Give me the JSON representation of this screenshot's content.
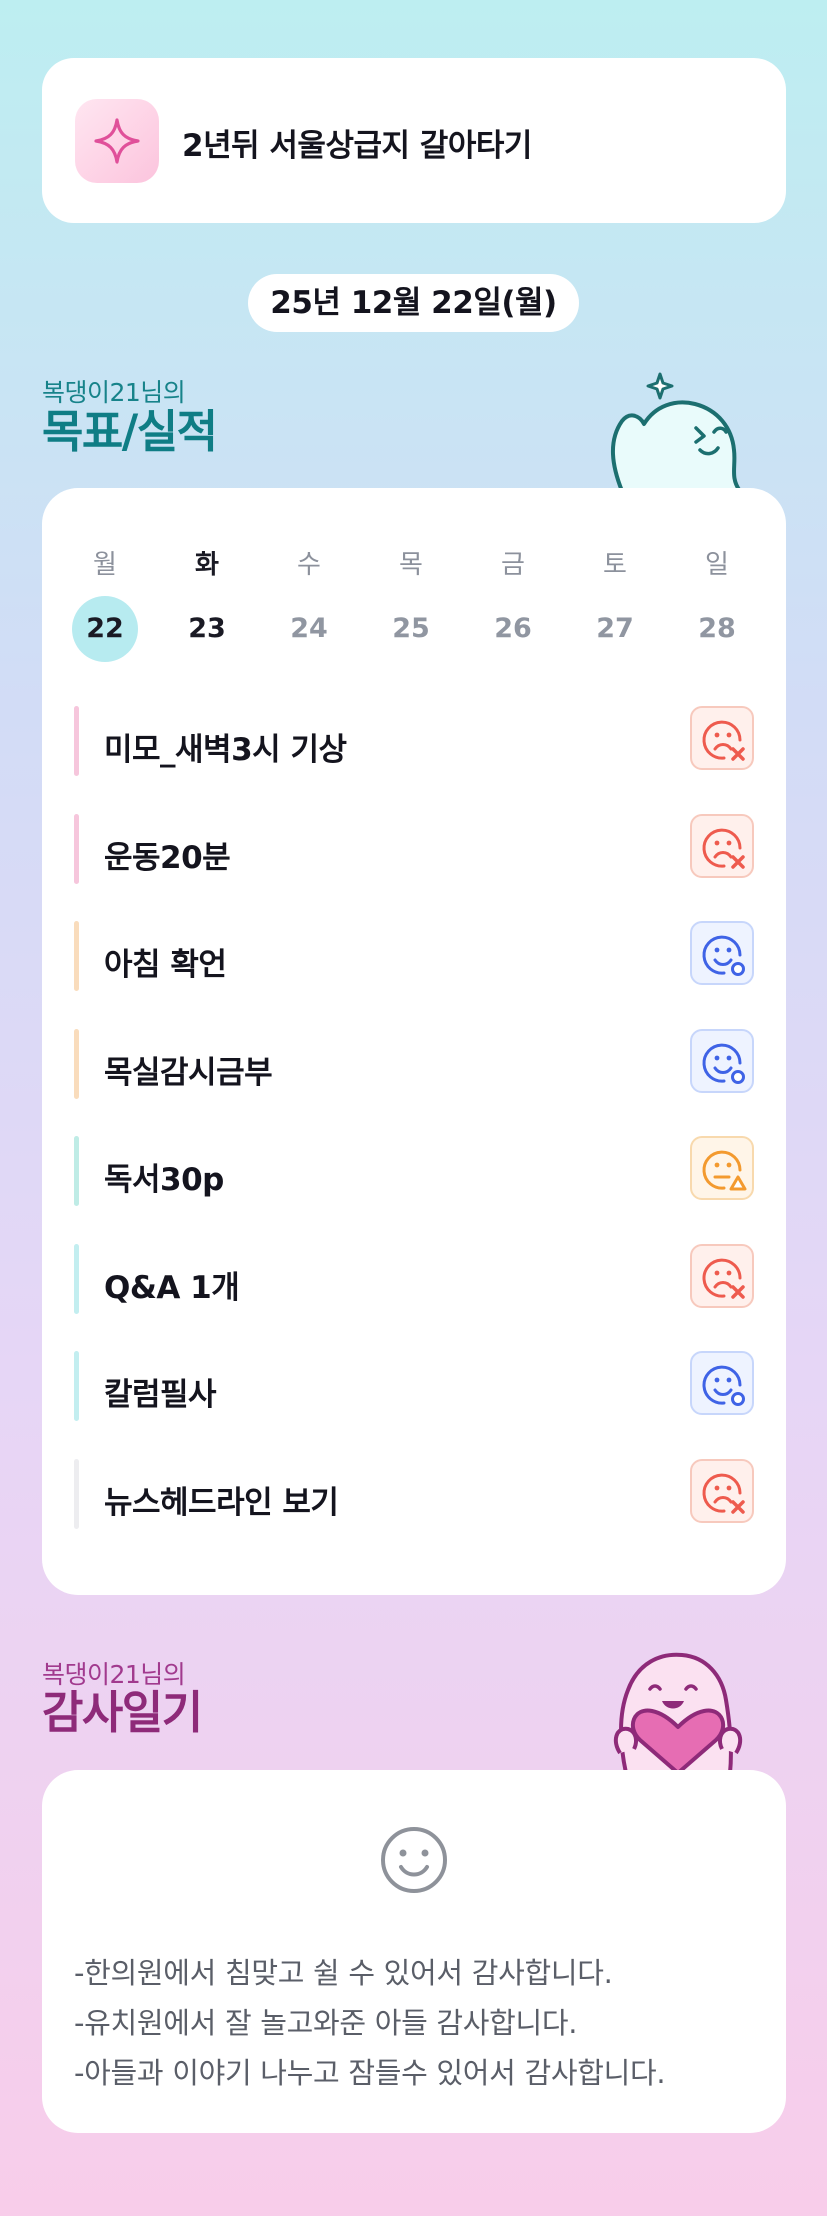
{
  "goal": {
    "title": "2년뒤 서울상급지 갈아타기",
    "icon": "sparkle-icon"
  },
  "date": "25년 12월 22일(월)",
  "goals_section": {
    "subtitle": "복댕이21님의",
    "title": "목표/실적"
  },
  "week": {
    "day_names": [
      "월",
      "화",
      "수",
      "목",
      "금",
      "토",
      "일"
    ],
    "day_numbers": [
      "22",
      "23",
      "24",
      "25",
      "26",
      "27",
      "28"
    ],
    "selected_index": 0,
    "today_index": 1
  },
  "goals": [
    {
      "label": "미모_새벽3시 기상",
      "bar_color": "#f6c6dc",
      "status": "fail"
    },
    {
      "label": "운동20분",
      "bar_color": "#f6c6dc",
      "status": "fail"
    },
    {
      "label": "아침 확언",
      "bar_color": "#f9dcbc",
      "status": "done"
    },
    {
      "label": "목실감시금부",
      "bar_color": "#f9dcbc",
      "status": "done"
    },
    {
      "label": "독서30p",
      "bar_color": "#bfece6",
      "status": "partial"
    },
    {
      "label": "Q&A 1개",
      "bar_color": "#c3eef0",
      "status": "fail"
    },
    {
      "label": "칼럼필사",
      "bar_color": "#c3eef0",
      "status": "done"
    },
    {
      "label": "뉴스헤드라인 보기",
      "bar_color": "#ededf0",
      "status": "fail"
    }
  ],
  "thanks_section": {
    "subtitle": "복댕이21님의",
    "title": "감사일기",
    "icon": "smiley-icon"
  },
  "thanks": [
    "-한의원에서 침맞고 쉴 수 있어서 감사합니다.",
    "-유치원에서 잘 놀고와준 아들 감사합니다.",
    "-아들과 이야기 나누고 잠들수 있어서 감사합니다."
  ],
  "colors": {
    "fail": "#ee5b4e",
    "done": "#3f63e6",
    "partial": "#f39a2f",
    "accent_teal": "#0f7d85",
    "accent_plum": "#8e2a79"
  }
}
